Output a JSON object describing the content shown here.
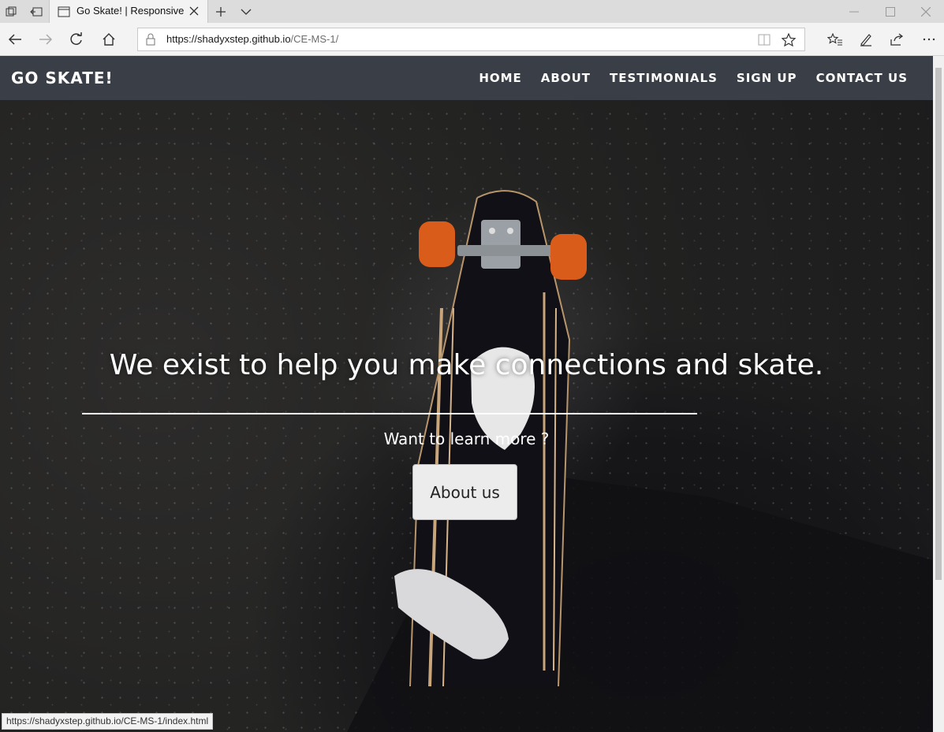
{
  "browser": {
    "tab_title": "Go Skate! | Responsive G",
    "url_host": "https://shadyxstep.github.io",
    "url_path": "/CE-MS-1/",
    "status_url": "https://shadyxstep.github.io/CE-MS-1/index.html"
  },
  "site": {
    "brand": "GO SKATE!",
    "nav": [
      "HOME",
      "ABOUT",
      "TESTIMONIALS",
      "SIGN UP",
      "CONTACT US"
    ]
  },
  "hero": {
    "headline": "We exist to help you make connections and skate.",
    "subheading": "Want to learn more ?",
    "button_label": "About us"
  },
  "colors": {
    "site_nav": "#3a3f47",
    "wheel": "#e0651f",
    "button_bg": "#ececec"
  }
}
